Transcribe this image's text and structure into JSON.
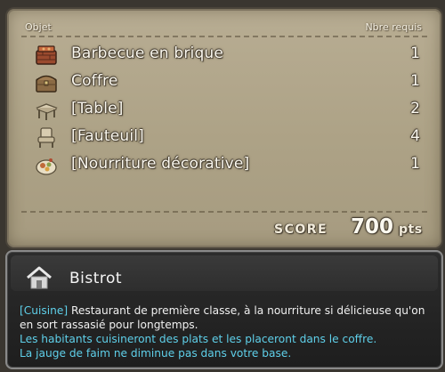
{
  "list": {
    "header_object": "Objet",
    "header_required": "Nbre requis",
    "items": [
      {
        "name": "Barbecue en brique",
        "qty": "1",
        "icon": "brick-barbecue-icon"
      },
      {
        "name": "Coffre",
        "qty": "1",
        "icon": "chest-icon"
      },
      {
        "name": "[Table]",
        "qty": "2",
        "icon": "table-icon"
      },
      {
        "name": "[Fauteuil]",
        "qty": "4",
        "icon": "armchair-icon"
      },
      {
        "name": "[Nourriture décorative]",
        "qty": "1",
        "icon": "decorative-food-icon"
      }
    ]
  },
  "score": {
    "label": "SCORE",
    "value": "700",
    "unit": "pts"
  },
  "info": {
    "title": "Bistrot",
    "icon": "house-icon",
    "tag": "[Cuisine]",
    "description_1": " Restaurant de première classe, à la nourriture si délicieuse qu'on en sort rassasié pour longtemps.",
    "effect_1": "Les habitants cuisineront des plats et les placeront dans le coffre.",
    "effect_2": "La jauge de faim ne diminue pas dans votre base.",
    "colors": {
      "highlight": "#5fd0ea",
      "text": "#f0f0f0"
    }
  }
}
